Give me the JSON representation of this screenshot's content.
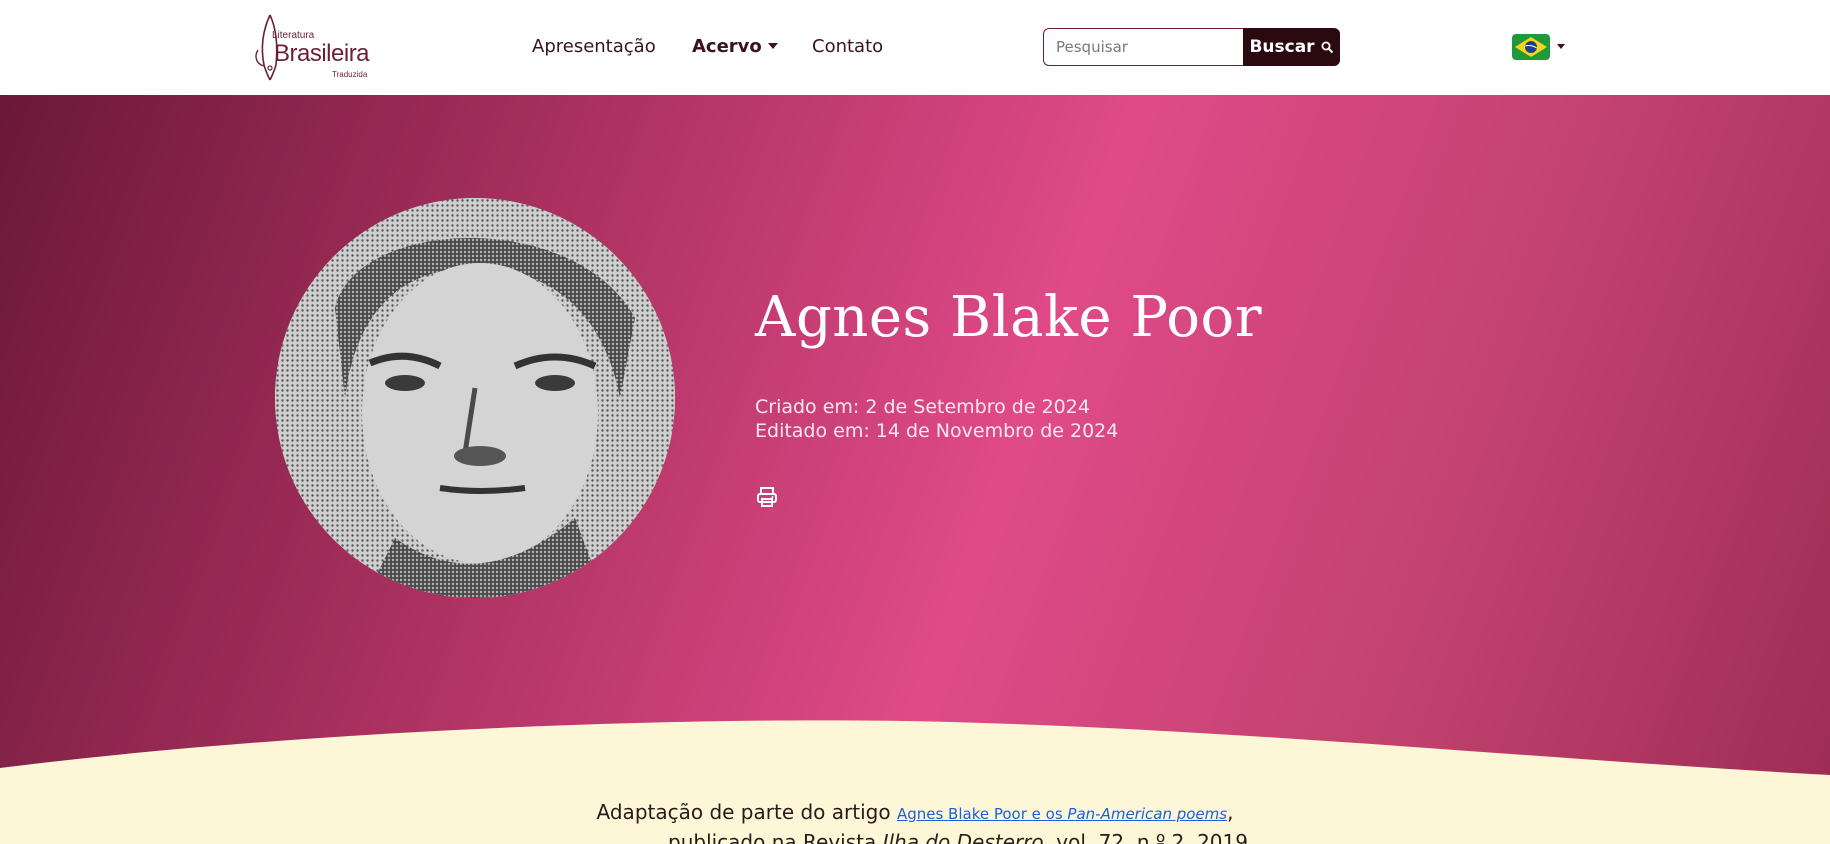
{
  "header": {
    "logo": {
      "small": "Literatura",
      "big": "Brasileira",
      "tiny": "Traduzida"
    },
    "nav": {
      "apresentacao": "Apresentação",
      "acervo": "Acervo",
      "contato": "Contato"
    },
    "search": {
      "placeholder": "Pesquisar",
      "button": "Buscar"
    },
    "language_flag": "brazil-flag"
  },
  "hero": {
    "title": "Agnes Blake Poor",
    "created": "Criado em: 2 de Setembro de 2024",
    "edited": "Editado em: 14 de Novembro de 2024",
    "print_icon": "printer-icon",
    "colors": {
      "gradient_start": "#6b1838",
      "gradient_mid": "#e04a88",
      "gradient_end": "#9e2d55"
    }
  },
  "content": {
    "intro": "Adaptação de parte do artigo ",
    "link_text_1": "Agnes Blake Poor e os ",
    "link_text_2": "Pan-American poems",
    "after_link": ",",
    "line2_a": "publicado na Revista ",
    "line2_b": "Ilha do Desterro",
    "line2_c": ", vol. 72, n.º 2, 2019."
  }
}
